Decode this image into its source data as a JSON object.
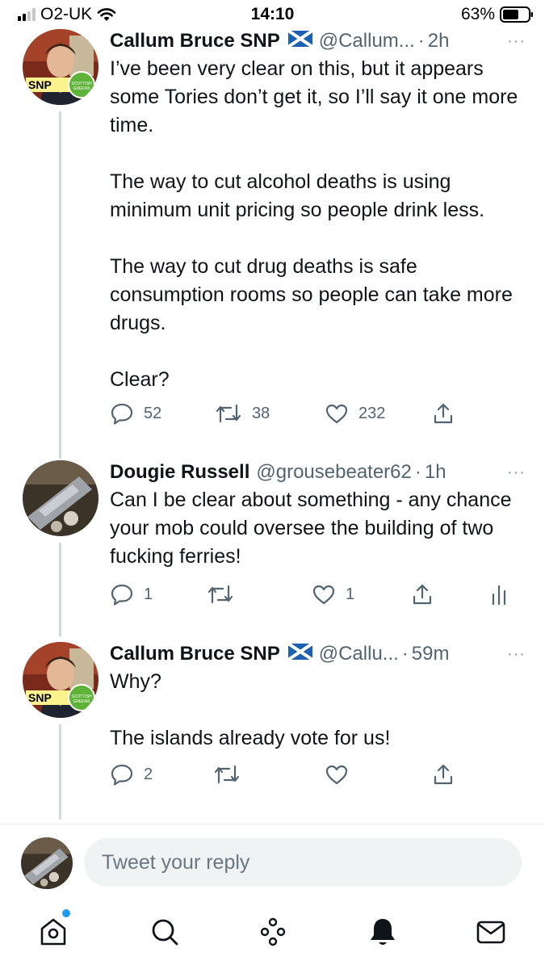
{
  "status_bar": {
    "carrier": "O2-UK",
    "time": "14:10",
    "battery": "63%",
    "battery_level": 0.63,
    "signal_bars": 2
  },
  "thread": [
    {
      "author": "Callum Bruce SNP",
      "handle": "@Callum...",
      "separator": "·",
      "time": "2h",
      "more": "···",
      "avatar_badges": [
        "SNP",
        "SCOTTISH GREENS"
      ],
      "text": [
        "I’ve been very clear on this, but it appears some Tories don’t get it, so I’ll say it one more time.",
        "",
        "The way to cut alcohol deaths is using minimum unit pricing so people drink less.",
        "",
        "The way to cut drug deaths is safe consumption rooms so people can take more drugs.",
        "",
        "Clear?"
      ],
      "replies": "52",
      "retweets": "38",
      "likes": "232"
    },
    {
      "author": "Dougie Russell",
      "handle": "@grousebeater62",
      "separator": "·",
      "time": "1h",
      "more": "···",
      "text": [
        "Can I be clear about something - any chance your mob could oversee the building of two fucking ferries!"
      ],
      "replies": "1",
      "retweets": "",
      "likes": "1"
    },
    {
      "author": "Callum Bruce SNP",
      "handle": "@Callu...",
      "separator": "·",
      "time": "59m",
      "more": "···",
      "avatar_badges": [
        "SNP",
        "SCOTTISH GREENS"
      ],
      "text": [
        "Why?",
        "",
        "The islands already vote for us!"
      ],
      "replies": "2",
      "retweets": "",
      "likes": ""
    }
  ],
  "reply_bar": {
    "placeholder": "Tweet your reply"
  },
  "tab_bar": {
    "items": [
      "home-icon",
      "search-icon",
      "spaces-icon",
      "notifications-icon",
      "messages-icon"
    ]
  },
  "colors": {
    "text": "#0f1419",
    "secondary": "#536471",
    "thread_line": "#cfd9de",
    "accent": "#1d9bf0",
    "snp_yellow": "#fdf38e",
    "greens": "#5fb238"
  }
}
